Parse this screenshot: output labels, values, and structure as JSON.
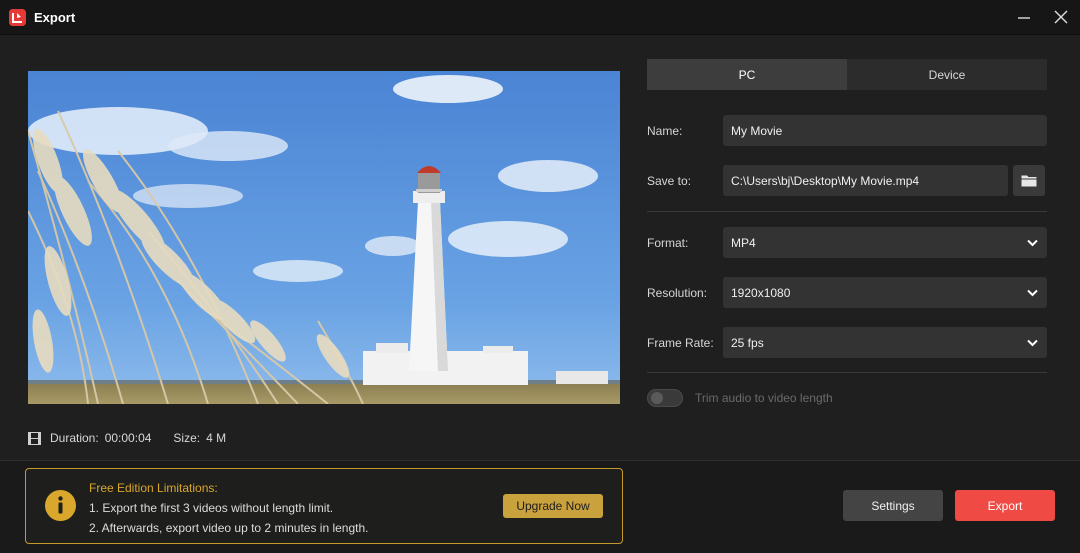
{
  "window": {
    "title": "Export"
  },
  "preview": {
    "duration_label": "Duration:",
    "duration_value": "00:00:04",
    "size_label": "Size:",
    "size_value": "4 M"
  },
  "tabs": [
    {
      "label": "PC",
      "active": true
    },
    {
      "label": "Device",
      "active": false
    }
  ],
  "form": {
    "name_label": "Name:",
    "name_value": "My Movie",
    "save_label": "Save to:",
    "save_value": "C:\\Users\\bj\\Desktop\\My Movie.mp4",
    "format_label": "Format:",
    "format_value": "MP4",
    "resolution_label": "Resolution:",
    "resolution_value": "1920x1080",
    "framerate_label": "Frame Rate:",
    "framerate_value": "25 fps",
    "trim_label": "Trim audio to video length",
    "trim_enabled": false
  },
  "limitations": {
    "title": "Free Edition Limitations:",
    "line1": "1. Export the first 3 videos without length limit.",
    "line2": "2. Afterwards, export video up to 2 minutes in length.",
    "upgrade_label": "Upgrade Now"
  },
  "actions": {
    "settings_label": "Settings",
    "export_label": "Export"
  },
  "icons": {
    "app": "app-logo-icon",
    "minimize": "minimize-icon",
    "close": "close-icon",
    "film": "film-icon",
    "folder": "folder-icon",
    "chevron": "chevron-down-icon",
    "info": "info-icon"
  },
  "colors": {
    "accent_red": "#f04a45",
    "gold": "#c9a13d",
    "background": "#1f1f1f"
  }
}
